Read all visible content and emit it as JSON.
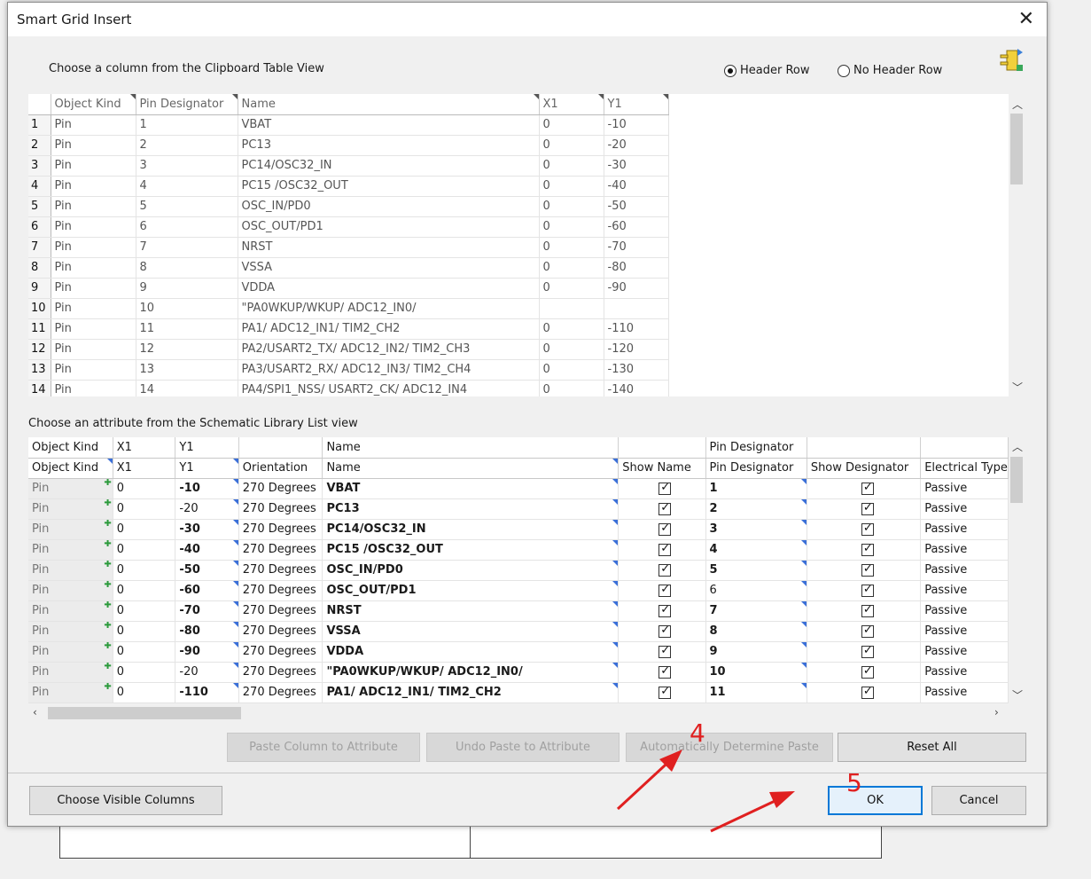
{
  "dialog": {
    "title": "Smart Grid Insert",
    "close_icon": "close-icon"
  },
  "clipboard": {
    "label": "Choose a column from the Clipboard Table View",
    "header_row_label": "Header Row",
    "no_header_row_label": "No Header Row",
    "selected": "Header Row",
    "columns": [
      "Object Kind",
      "Pin Designator",
      "Name",
      "X1",
      "Y1"
    ],
    "rows": [
      [
        "1",
        "Pin",
        "1",
        "VBAT",
        "0",
        "-10"
      ],
      [
        "2",
        "Pin",
        "2",
        "PC13",
        "0",
        "-20"
      ],
      [
        "3",
        "Pin",
        "3",
        "PC14/OSC32_IN",
        "0",
        "-30"
      ],
      [
        "4",
        "Pin",
        "4",
        "PC15 /OSC32_OUT",
        "0",
        "-40"
      ],
      [
        "5",
        "Pin",
        "5",
        "OSC_IN/PD0",
        "0",
        "-50"
      ],
      [
        "6",
        "Pin",
        "6",
        "OSC_OUT/PD1",
        "0",
        "-60"
      ],
      [
        "7",
        "Pin",
        "7",
        "NRST",
        "0",
        "-70"
      ],
      [
        "8",
        "Pin",
        "8",
        "VSSA",
        "0",
        "-80"
      ],
      [
        "9",
        "Pin",
        "9",
        "VDDA",
        "0",
        "-90"
      ],
      [
        "10",
        "Pin",
        "10",
        "\"PA0WKUP/WKUP/  ADC12_IN0/",
        "",
        ""
      ],
      [
        "11",
        "Pin",
        "11",
        "PA1/ ADC12_IN1/ TIM2_CH2",
        "0",
        "-110"
      ],
      [
        "12",
        "Pin",
        "12",
        "PA2/USART2_TX/ ADC12_IN2/ TIM2_CH3",
        "0",
        "-120"
      ],
      [
        "13",
        "Pin",
        "13",
        "PA3/USART2_RX/ ADC12_IN3/ TIM2_CH4",
        "0",
        "-130"
      ],
      [
        "14",
        "Pin",
        "14",
        "PA4/SPI1_NSS/ USART2_CK/ ADC12_IN4",
        "0",
        "-140"
      ]
    ]
  },
  "library": {
    "label": "Choose an attribute from the Schematic Library List view",
    "header1": [
      "Object Kind",
      "X1",
      "Y1",
      "",
      "Name",
      "",
      "Pin Designator",
      "",
      ""
    ],
    "header2": [
      "Object Kind",
      "X1",
      "Y1",
      "Orientation",
      "Name",
      "Show Name",
      "Pin Designator",
      "Show Designator",
      "Electrical Type"
    ],
    "rows": [
      {
        "kind": "Pin",
        "x1": "0",
        "y1": "-10",
        "orient": "270 Degrees",
        "name": "VBAT",
        "des": "1",
        "type": "Passive"
      },
      {
        "kind": "Pin",
        "x1": "0",
        "y1": "-20",
        "orient": "270 Degrees",
        "name": "PC13",
        "des": "2",
        "type": "Passive"
      },
      {
        "kind": "Pin",
        "x1": "0",
        "y1": "-30",
        "orient": "270 Degrees",
        "name": "PC14/OSC32_IN",
        "des": "3",
        "type": "Passive"
      },
      {
        "kind": "Pin",
        "x1": "0",
        "y1": "-40",
        "orient": "270 Degrees",
        "name": "PC15 /OSC32_OUT",
        "des": "4",
        "type": "Passive"
      },
      {
        "kind": "Pin",
        "x1": "0",
        "y1": "-50",
        "orient": "270 Degrees",
        "name": "OSC_IN/PD0",
        "des": "5",
        "type": "Passive"
      },
      {
        "kind": "Pin",
        "x1": "0",
        "y1": "-60",
        "orient": "270 Degrees",
        "name": "OSC_OUT/PD1",
        "des": "6",
        "type": "Passive"
      },
      {
        "kind": "Pin",
        "x1": "0",
        "y1": "-70",
        "orient": "270 Degrees",
        "name": "NRST",
        "des": "7",
        "type": "Passive"
      },
      {
        "kind": "Pin",
        "x1": "0",
        "y1": "-80",
        "orient": "270 Degrees",
        "name": "VSSA",
        "des": "8",
        "type": "Passive"
      },
      {
        "kind": "Pin",
        "x1": "0",
        "y1": "-90",
        "orient": "270 Degrees",
        "name": "VDDA",
        "des": "9",
        "type": "Passive"
      },
      {
        "kind": "Pin",
        "x1": "0",
        "y1": "-20",
        "orient": "270 Degrees",
        "name": "\"PA0WKUP/WKUP/  ADC12_IN0/",
        "des": "10",
        "type": "Passive"
      },
      {
        "kind": "Pin",
        "x1": "0",
        "y1": "-110",
        "orient": "270 Degrees",
        "name": "PA1/ ADC12_IN1/ TIM2_CH2",
        "des": "11",
        "type": "Passive"
      }
    ]
  },
  "buttons": {
    "paste_column": "Paste Column to Attribute",
    "undo_paste": "Undo Paste to Attribute",
    "auto_determine": "Automatically Determine Paste",
    "reset_all": "Reset All",
    "choose_visible": "Choose Visible Columns",
    "ok": "OK",
    "cancel": "Cancel"
  },
  "annotations": {
    "step4": "4",
    "step5": "5",
    "color": "#e02020"
  }
}
